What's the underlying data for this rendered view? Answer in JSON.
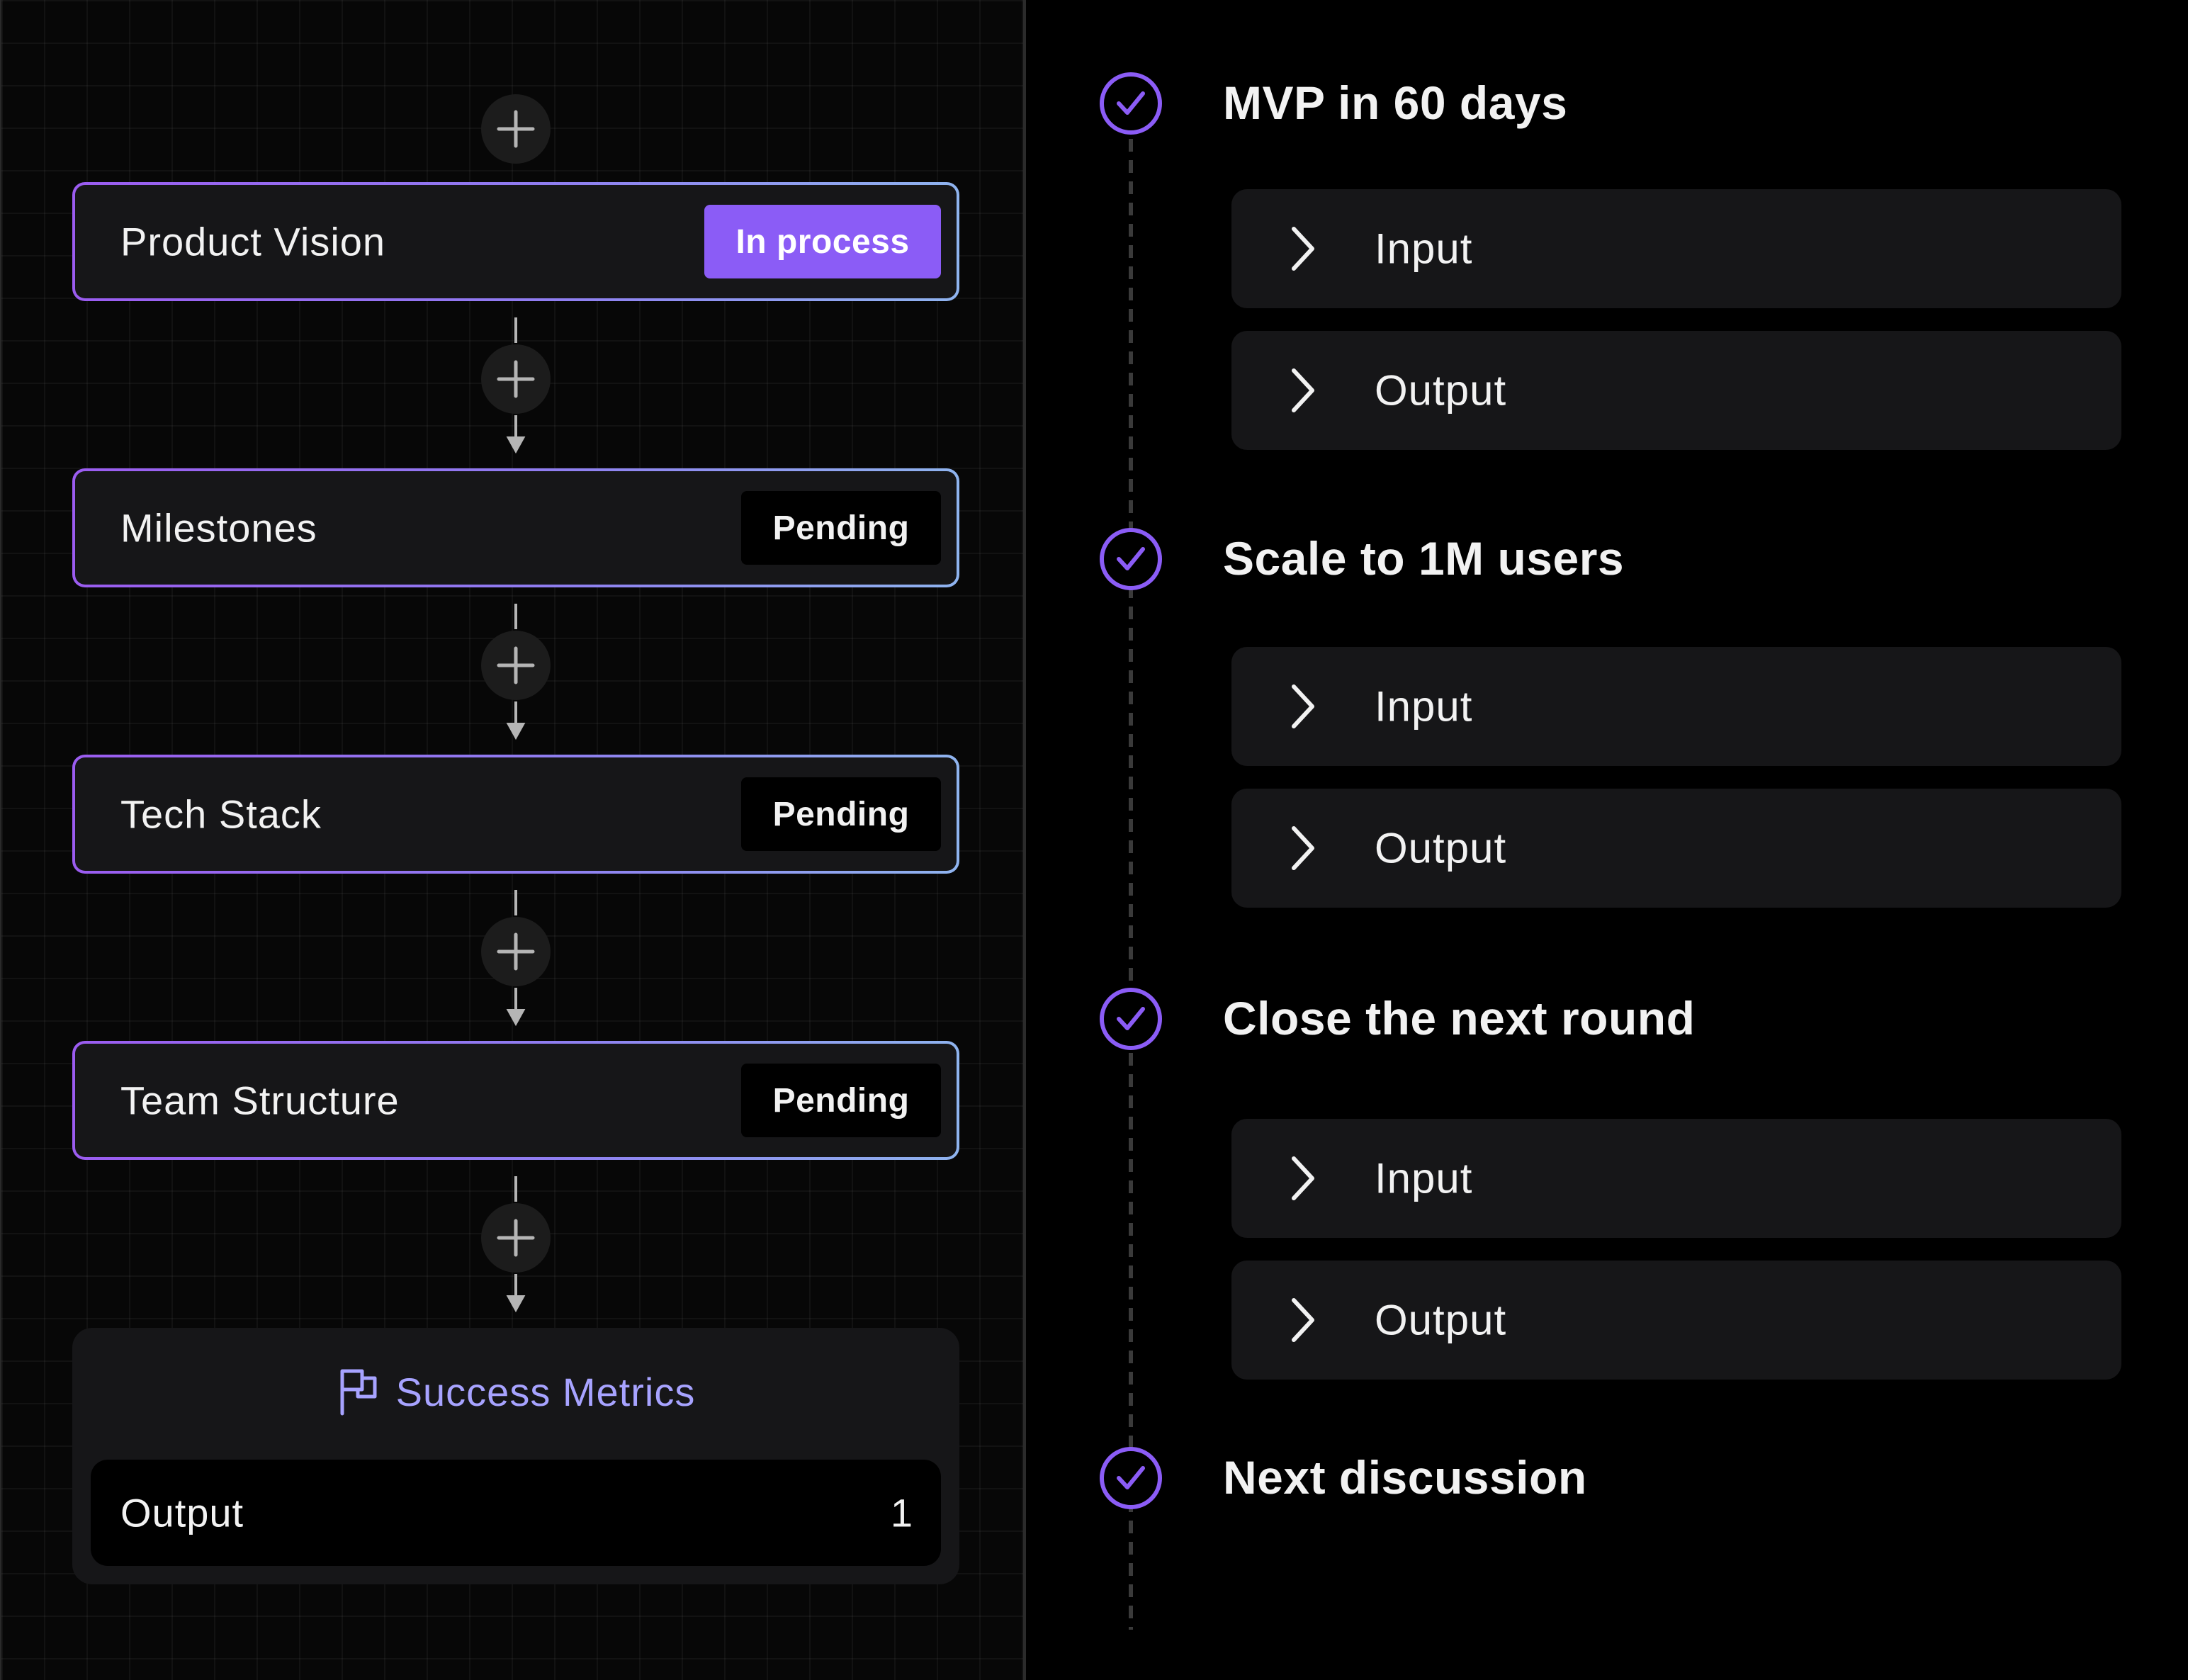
{
  "workflow": {
    "steps": [
      {
        "title": "Product Vision",
        "status": "In process"
      },
      {
        "title": "Milestones",
        "status": "Pending"
      },
      {
        "title": "Tech Stack",
        "status": "Pending"
      },
      {
        "title": "Team Structure",
        "status": "Pending"
      }
    ],
    "metrics": {
      "title": "Success Metrics",
      "icon": "flag-icon",
      "output_label": "Output",
      "output_value": "1"
    }
  },
  "timeline": {
    "milestones": [
      {
        "title": "MVP in 60 days",
        "input_label": "Input",
        "output_label": "Output"
      },
      {
        "title": "Scale to 1M users",
        "input_label": "Input",
        "output_label": "Output"
      },
      {
        "title": "Close the next round",
        "input_label": "Input",
        "output_label": "Output"
      },
      {
        "title": "Next discussion"
      }
    ]
  },
  "colors": {
    "accent": "#8b5cf6",
    "metrics_text": "#a7a3ff",
    "card_bg": "#161618",
    "border_gradient_start": "#9b5cf0",
    "border_gradient_end": "#8fb4ef"
  }
}
